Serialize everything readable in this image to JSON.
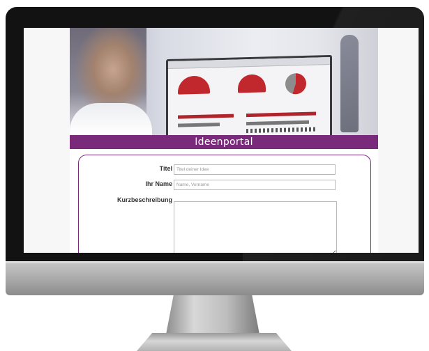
{
  "page": {
    "title": "Ideenportal"
  },
  "form": {
    "title_label": "Titel",
    "title_placeholder": "Titel deiner Idee",
    "name_label": "Ihr Name",
    "name_placeholder": "Name, Vorname",
    "description_label": "Kurzbeschreibung",
    "description_value": ""
  },
  "colors": {
    "accent": "#7a2a7a",
    "bezel": "#121212",
    "chin": "#a8a8a8"
  }
}
